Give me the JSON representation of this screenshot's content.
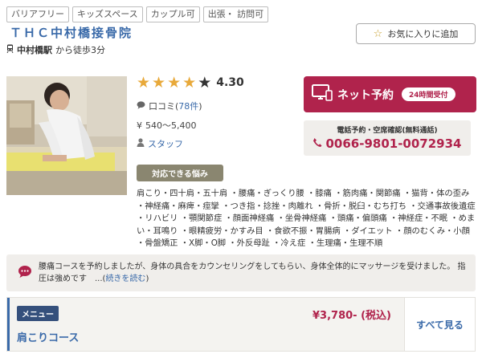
{
  "tags": [
    "バリアフリー",
    "キッズスペース",
    "カップル可",
    "出張・ 訪問可"
  ],
  "clinic": {
    "name": "ＴＨＣ中村橋接骨院",
    "station": "中村橋駅",
    "access": "から徒歩3分"
  },
  "favorite": {
    "label": "お気に入りに追加"
  },
  "rating": {
    "score": "4.30",
    "stars": 4,
    "max_stars": 5
  },
  "reviews": {
    "label": "口コミ(",
    "count": "78件",
    "close": ")"
  },
  "price_range": "540～5,400",
  "staff": {
    "label": "スタッフ"
  },
  "net_reserve": {
    "label": "ネット予約",
    "badge": "24時間受付"
  },
  "phone": {
    "caption": "電話予約・空席確認(無料通話)",
    "number": "0066-9801-0072934"
  },
  "worries": {
    "badge": "対応できる悩み",
    "text": "肩こり・四十肩・五十肩 ・腰痛・ぎっくり腰 ・膝痛 ・筋肉痛・関節痛 ・猫背・体の歪み ・神経痛・麻痺・痙攣 ・つき指・捻挫・肉離れ ・骨折・脱臼・むち打ち ・交通事故後遺症 ・リハビリ ・顎関節症 ・顔面神経痛 ・坐骨神経痛 ・頭痛・偏頭痛 ・神経症・不眠 ・めまい・耳鳴り ・眼精疲労・かすみ目 ・食欲不振・胃腸病 ・ダイエット ・顔のむくみ・小顔 ・骨盤矯正 ・X脚・O脚 ・外反母趾 ・冷え症 ・生理痛・生理不順"
  },
  "review": {
    "text": "腰痛コースを予約しましたが、身体の具合をカウンセリングをしてもらい、身体全体的にマッサージを受けました。 指圧は強めです　...(",
    "more": "続きを読む",
    "close": ")"
  },
  "menu": {
    "chip": "メニュー",
    "course": "肩こりコース",
    "price": "¥3,780- (税込)",
    "see_all": "すべて見る"
  },
  "colors": {
    "brand_blue": "#3a6aa9",
    "accent_red": "#b0234c",
    "star": "#e8a93a",
    "badge_olive": "#8a8670"
  }
}
